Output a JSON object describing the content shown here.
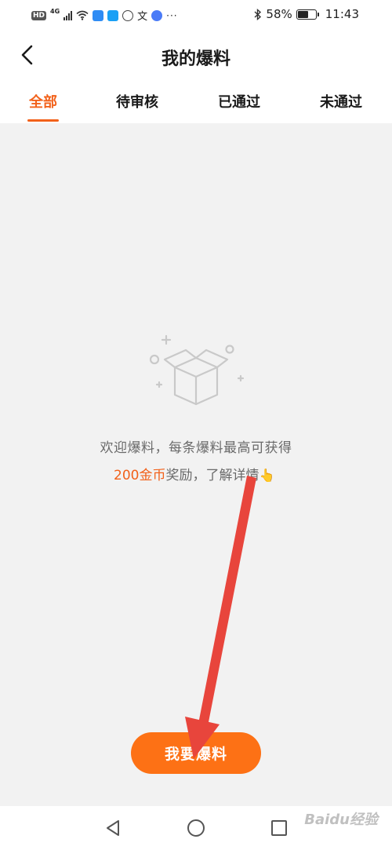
{
  "status_bar": {
    "hd": "HD",
    "network": "4G",
    "more": "···",
    "battery": "58%",
    "battery_level": 0.58,
    "time": "11:43"
  },
  "header": {
    "title": "我的爆料"
  },
  "tabs": [
    {
      "label": "全部",
      "active": true
    },
    {
      "label": "待审核",
      "active": false
    },
    {
      "label": "已通过",
      "active": false
    },
    {
      "label": "未通过",
      "active": false
    }
  ],
  "empty_state": {
    "line1": "欢迎爆料，每条爆料最高可获得",
    "coins": "200金币",
    "line2_rest": "奖励，了解详情",
    "pointer": "👆"
  },
  "cta": {
    "label": "我要爆料"
  },
  "watermark": "Baidu经验",
  "colors": {
    "accent": "#f2611a",
    "button": "#fd7115",
    "background": "#f2f2f2",
    "annotation_arrow": "#e8453c"
  },
  "icons": {
    "back": "chevron-left-icon",
    "empty": "open-box-icon",
    "nav_back": "triangle-back-icon",
    "nav_home": "circle-home-icon",
    "nav_recent": "square-recent-icon"
  }
}
